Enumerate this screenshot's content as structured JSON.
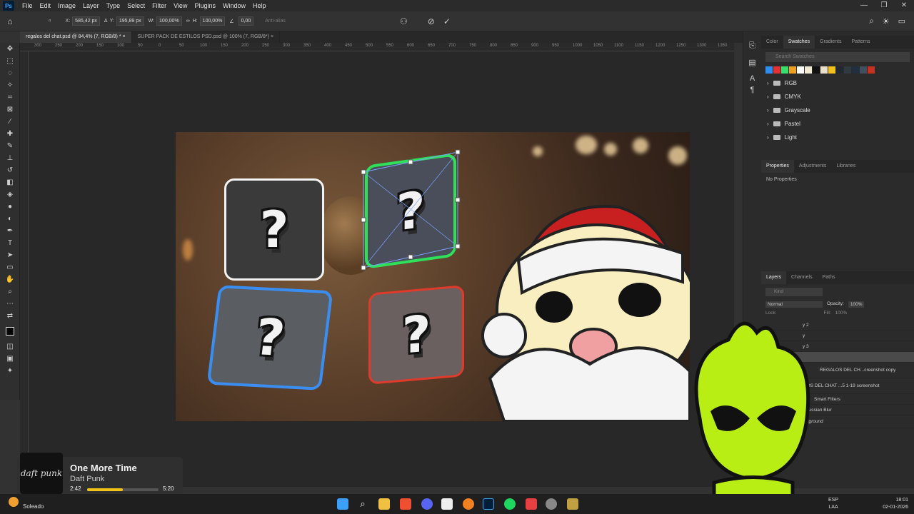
{
  "menubar": {
    "app_icon": "Ps",
    "items": [
      "File",
      "Edit",
      "Image",
      "Layer",
      "Type",
      "Select",
      "Filter",
      "View",
      "Plugins",
      "Window",
      "Help"
    ]
  },
  "window_controls": {
    "minimize": "—",
    "maximize": "❐",
    "close": "✕"
  },
  "options": {
    "x_label": "X:",
    "x_value": "585,42 px",
    "y_label": "Y:",
    "y_value": "195,89 px",
    "w_label": "W:",
    "w_value": "100,00%",
    "h_label": "H:",
    "h_value": "100,00%",
    "angle_value": "0,00",
    "antialias": "Anti-alias"
  },
  "tabs": [
    {
      "label": "regalos del chat.psd @ 84,4% (7, RGB/8) *",
      "close": "×"
    },
    {
      "label": "SUPER PACK DE ESTILOS PSD.psd @ 100% (7, RGB/8*)",
      "close": "×"
    }
  ],
  "ruler": {
    "ticks": [
      "300",
      "250",
      "200",
      "150",
      "100",
      "50",
      "0",
      "50",
      "100",
      "150",
      "200",
      "250",
      "300",
      "350",
      "400",
      "450",
      "500",
      "550",
      "600",
      "650",
      "700",
      "750",
      "800",
      "850",
      "900",
      "950",
      "1000",
      "1050",
      "1100",
      "1150",
      "1200",
      "1250",
      "1300",
      "1350"
    ]
  },
  "canvas": {
    "qmark": "?"
  },
  "swatches_panel": {
    "tabs": [
      "Color",
      "Swatches",
      "Gradients",
      "Patterns"
    ],
    "active": "Swatches",
    "search_placeholder": "Search Swatches",
    "colors": [
      "#2f8cf0",
      "#e33030",
      "#33e06a",
      "#f0a020",
      "#ffffff",
      "#f0e8d0",
      "#111111",
      "#e8e0c8",
      "#f0c020",
      "#202830",
      "#303840",
      "#203040",
      "#405060",
      "#c83020"
    ],
    "folders": [
      "RGB",
      "CMYK",
      "Grayscale",
      "Pastel",
      "Light"
    ]
  },
  "properties_panel": {
    "tabs": [
      "Properties",
      "Adjustments",
      "Libraries"
    ],
    "active": "Properties",
    "content": "No Properties"
  },
  "layers_panel": {
    "tabs": [
      "Layers",
      "Channels",
      "Paths"
    ],
    "active": "Layers",
    "kind": "Kind",
    "blend": "Normal",
    "opacity_label": "Opacity:",
    "opacity": "100%",
    "lock": "Lock:",
    "fill_label": "Fill:",
    "fill": "100%",
    "layers": [
      "y 2",
      "y",
      "y 3",
      "",
      "REGALOS DEL CH...creenshot copy",
      "LOS DEL CHAT ...5 1-19 screenshot",
      "Smart Filters",
      "Gaussian Blur",
      "Background"
    ]
  },
  "music": {
    "title": "One More Time",
    "artist": "Daft Punk",
    "album_art": "daft punk",
    "elapsed": "2:42",
    "total": "5:20",
    "progress": 0.5
  },
  "taskbar": {
    "weather_status": "Soleado",
    "lang1": "ESP",
    "lang2": "LAA",
    "time": "18:01",
    "date": "02-01-2026"
  }
}
